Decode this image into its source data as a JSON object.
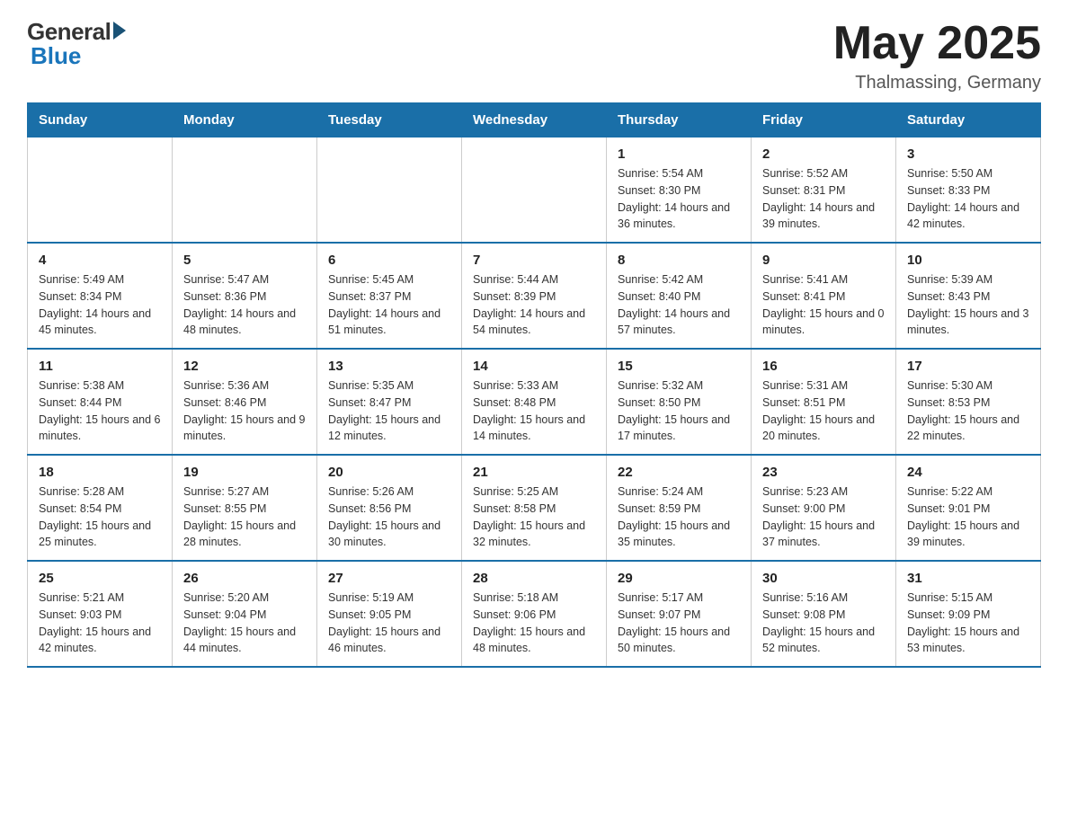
{
  "header": {
    "logo": {
      "general": "General",
      "blue": "Blue"
    },
    "title": "May 2025",
    "location": "Thalmassing, Germany"
  },
  "weekdays": [
    "Sunday",
    "Monday",
    "Tuesday",
    "Wednesday",
    "Thursday",
    "Friday",
    "Saturday"
  ],
  "weeks": [
    [
      {
        "day": "",
        "info": ""
      },
      {
        "day": "",
        "info": ""
      },
      {
        "day": "",
        "info": ""
      },
      {
        "day": "",
        "info": ""
      },
      {
        "day": "1",
        "info": "Sunrise: 5:54 AM\nSunset: 8:30 PM\nDaylight: 14 hours and 36 minutes."
      },
      {
        "day": "2",
        "info": "Sunrise: 5:52 AM\nSunset: 8:31 PM\nDaylight: 14 hours and 39 minutes."
      },
      {
        "day": "3",
        "info": "Sunrise: 5:50 AM\nSunset: 8:33 PM\nDaylight: 14 hours and 42 minutes."
      }
    ],
    [
      {
        "day": "4",
        "info": "Sunrise: 5:49 AM\nSunset: 8:34 PM\nDaylight: 14 hours and 45 minutes."
      },
      {
        "day": "5",
        "info": "Sunrise: 5:47 AM\nSunset: 8:36 PM\nDaylight: 14 hours and 48 minutes."
      },
      {
        "day": "6",
        "info": "Sunrise: 5:45 AM\nSunset: 8:37 PM\nDaylight: 14 hours and 51 minutes."
      },
      {
        "day": "7",
        "info": "Sunrise: 5:44 AM\nSunset: 8:39 PM\nDaylight: 14 hours and 54 minutes."
      },
      {
        "day": "8",
        "info": "Sunrise: 5:42 AM\nSunset: 8:40 PM\nDaylight: 14 hours and 57 minutes."
      },
      {
        "day": "9",
        "info": "Sunrise: 5:41 AM\nSunset: 8:41 PM\nDaylight: 15 hours and 0 minutes."
      },
      {
        "day": "10",
        "info": "Sunrise: 5:39 AM\nSunset: 8:43 PM\nDaylight: 15 hours and 3 minutes."
      }
    ],
    [
      {
        "day": "11",
        "info": "Sunrise: 5:38 AM\nSunset: 8:44 PM\nDaylight: 15 hours and 6 minutes."
      },
      {
        "day": "12",
        "info": "Sunrise: 5:36 AM\nSunset: 8:46 PM\nDaylight: 15 hours and 9 minutes."
      },
      {
        "day": "13",
        "info": "Sunrise: 5:35 AM\nSunset: 8:47 PM\nDaylight: 15 hours and 12 minutes."
      },
      {
        "day": "14",
        "info": "Sunrise: 5:33 AM\nSunset: 8:48 PM\nDaylight: 15 hours and 14 minutes."
      },
      {
        "day": "15",
        "info": "Sunrise: 5:32 AM\nSunset: 8:50 PM\nDaylight: 15 hours and 17 minutes."
      },
      {
        "day": "16",
        "info": "Sunrise: 5:31 AM\nSunset: 8:51 PM\nDaylight: 15 hours and 20 minutes."
      },
      {
        "day": "17",
        "info": "Sunrise: 5:30 AM\nSunset: 8:53 PM\nDaylight: 15 hours and 22 minutes."
      }
    ],
    [
      {
        "day": "18",
        "info": "Sunrise: 5:28 AM\nSunset: 8:54 PM\nDaylight: 15 hours and 25 minutes."
      },
      {
        "day": "19",
        "info": "Sunrise: 5:27 AM\nSunset: 8:55 PM\nDaylight: 15 hours and 28 minutes."
      },
      {
        "day": "20",
        "info": "Sunrise: 5:26 AM\nSunset: 8:56 PM\nDaylight: 15 hours and 30 minutes."
      },
      {
        "day": "21",
        "info": "Sunrise: 5:25 AM\nSunset: 8:58 PM\nDaylight: 15 hours and 32 minutes."
      },
      {
        "day": "22",
        "info": "Sunrise: 5:24 AM\nSunset: 8:59 PM\nDaylight: 15 hours and 35 minutes."
      },
      {
        "day": "23",
        "info": "Sunrise: 5:23 AM\nSunset: 9:00 PM\nDaylight: 15 hours and 37 minutes."
      },
      {
        "day": "24",
        "info": "Sunrise: 5:22 AM\nSunset: 9:01 PM\nDaylight: 15 hours and 39 minutes."
      }
    ],
    [
      {
        "day": "25",
        "info": "Sunrise: 5:21 AM\nSunset: 9:03 PM\nDaylight: 15 hours and 42 minutes."
      },
      {
        "day": "26",
        "info": "Sunrise: 5:20 AM\nSunset: 9:04 PM\nDaylight: 15 hours and 44 minutes."
      },
      {
        "day": "27",
        "info": "Sunrise: 5:19 AM\nSunset: 9:05 PM\nDaylight: 15 hours and 46 minutes."
      },
      {
        "day": "28",
        "info": "Sunrise: 5:18 AM\nSunset: 9:06 PM\nDaylight: 15 hours and 48 minutes."
      },
      {
        "day": "29",
        "info": "Sunrise: 5:17 AM\nSunset: 9:07 PM\nDaylight: 15 hours and 50 minutes."
      },
      {
        "day": "30",
        "info": "Sunrise: 5:16 AM\nSunset: 9:08 PM\nDaylight: 15 hours and 52 minutes."
      },
      {
        "day": "31",
        "info": "Sunrise: 5:15 AM\nSunset: 9:09 PM\nDaylight: 15 hours and 53 minutes."
      }
    ]
  ]
}
